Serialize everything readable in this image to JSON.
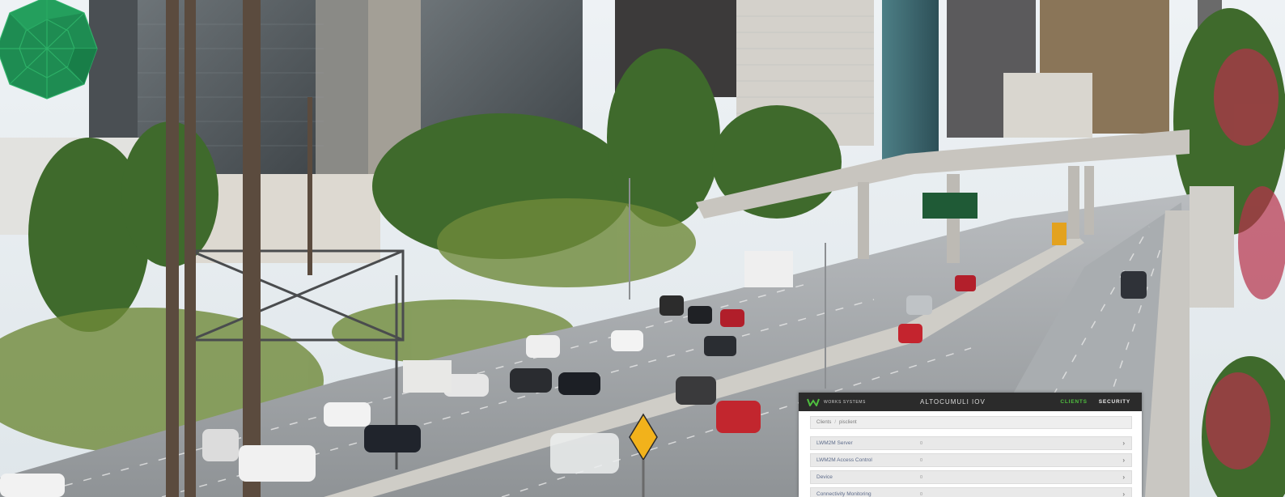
{
  "app": {
    "brand": "WORKS SYSTEMS",
    "title": "ALTOCUMULI IOV",
    "nav": [
      {
        "label": "CLIENTS",
        "active": true
      },
      {
        "label": "SECURITY",
        "active": false
      }
    ]
  },
  "breadcrumb": {
    "root": "Clients",
    "current": "pisclient"
  },
  "rows": [
    {
      "label": "LWM2M Server",
      "count": "0"
    },
    {
      "label": "LWM2M Access Control",
      "count": "0"
    },
    {
      "label": "Device",
      "count": "0"
    },
    {
      "label": "Connectivity Monitoring",
      "count": "0"
    }
  ],
  "colors": {
    "topbar": "#2b2b2b",
    "accent": "#4fbf3f",
    "gem": "#1e8c52"
  },
  "icons": {
    "logo": "works-systems-logo-icon",
    "chevron": "chevron-right-icon",
    "gem": "green-geodesic-icon"
  }
}
